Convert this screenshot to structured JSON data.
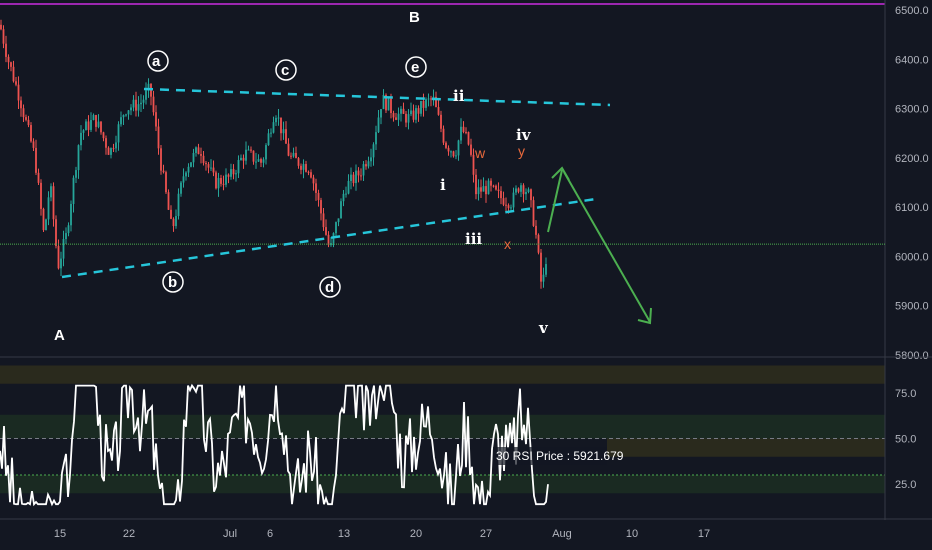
{
  "chart_data": [
    {
      "type": "candlestick",
      "price_axis": {
        "ticks": [
          5800,
          5900,
          6000,
          6100,
          6200,
          6300,
          6400,
          6500
        ],
        "ylim": [
          5790,
          6520
        ]
      },
      "date_axis": {
        "ticks": [
          "15",
          "22",
          "Jul",
          "6",
          "13",
          "20",
          "27",
          "Aug",
          "10",
          "17"
        ]
      },
      "current_price_line": 6025,
      "wave_labels": {
        "A": "A",
        "B": "B",
        "a": "a",
        "b": "b",
        "c": "c",
        "d": "d",
        "e": "e",
        "i": "i",
        "ii": "ii",
        "iii": "iii",
        "iv": "iv",
        "v": "v",
        "w": "w",
        "x": "x",
        "y": "y"
      },
      "trendlines": [
        {
          "name": "upper",
          "from": [
            6340,
            0.155
          ],
          "to": [
            6305,
            0.655
          ]
        },
        {
          "name": "lower",
          "from": [
            5960,
            0.068
          ],
          "to": [
            6115,
            0.64
          ]
        }
      ],
      "colors": {
        "up": "#26a69a",
        "down": "#ef5350",
        "trendline": "#26c6da",
        "arrow": "#4caf50",
        "top_line": "#9c27b0"
      }
    },
    {
      "type": "line",
      "title": "RSI",
      "series": [
        {
          "name": "30 RSI Price",
          "last_value": "5921.679"
        }
      ],
      "y_axis": {
        "ticks": [
          "25.0",
          "50.0",
          "75.0"
        ],
        "ylim": [
          7,
          93
        ]
      },
      "label": "30 RSI Price : 5921.679"
    }
  ]
}
